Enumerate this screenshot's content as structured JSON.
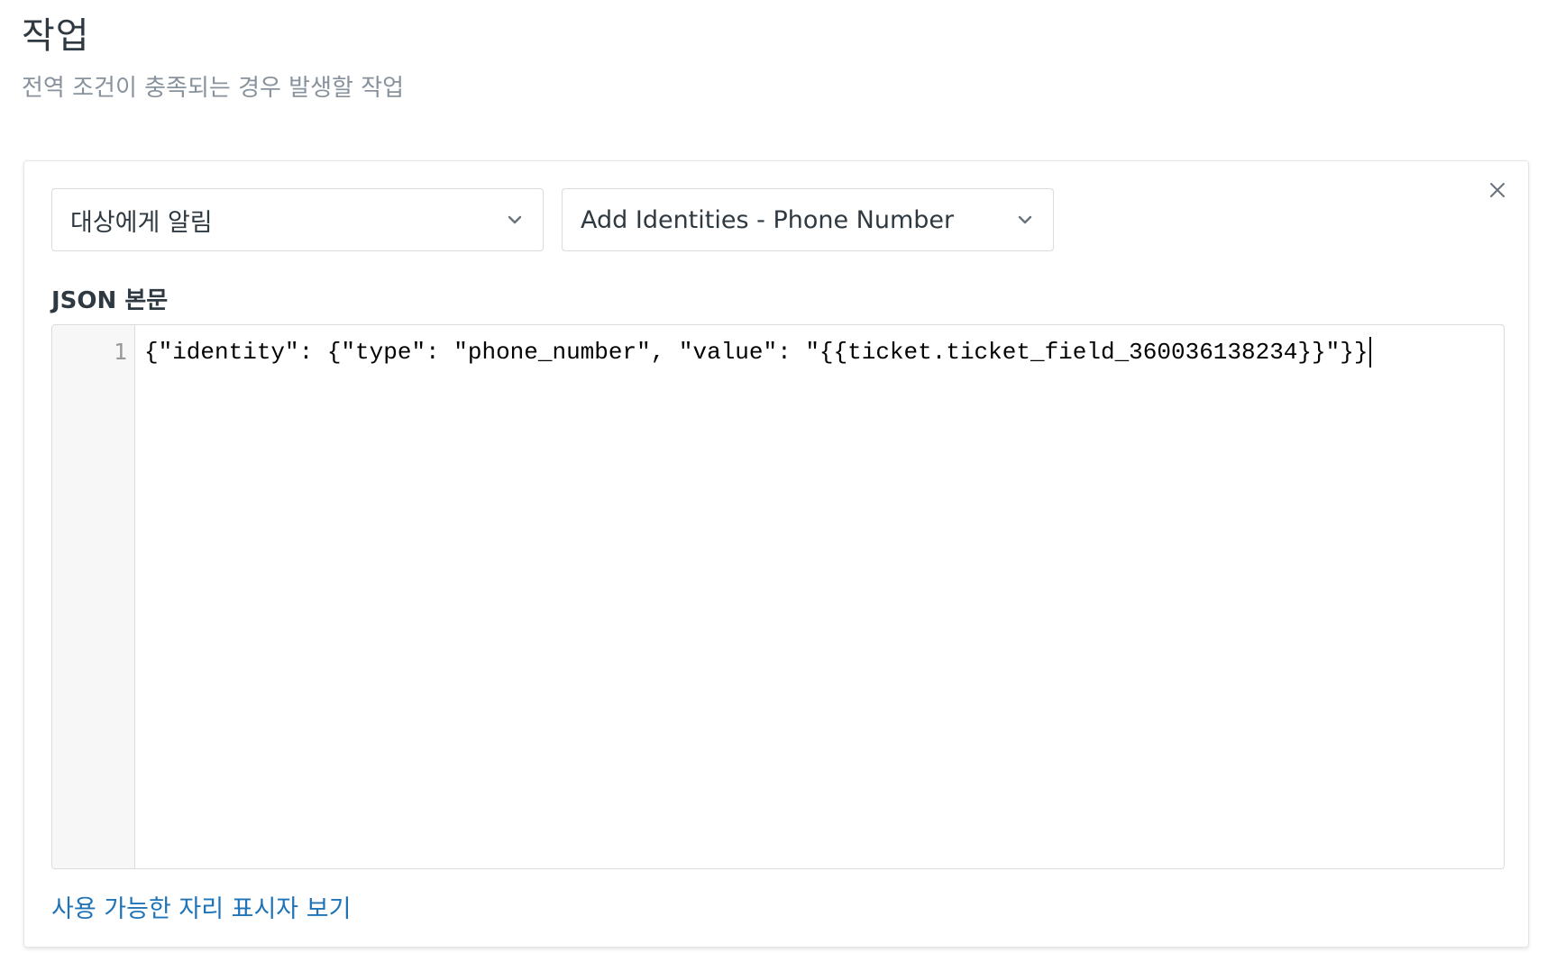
{
  "header": {
    "title": "작업",
    "subtitle": "전역 조건이 충족되는 경우 발생할 작업"
  },
  "action": {
    "target_select": {
      "value": "대상에게 알림"
    },
    "webhook_select": {
      "value": "Add Identities - Phone Number"
    },
    "json_body_label": "JSON 본문",
    "editor": {
      "line_numbers": [
        "1"
      ],
      "lines": [
        "{\"identity\": {\"type\": \"phone_number\", \"value\": \"{{ticket.ticket_field_360036138234}}\"}}"
      ]
    },
    "placeholder_link": "사용 가능한 자리 표시자 보기"
  },
  "icons": {
    "close": "close-icon",
    "dropdown": "chevron-down-icon"
  },
  "colors": {
    "link": "#1f73b7",
    "subtitle": "#87929d",
    "text": "#2f3941",
    "border": "#d8dcde"
  }
}
